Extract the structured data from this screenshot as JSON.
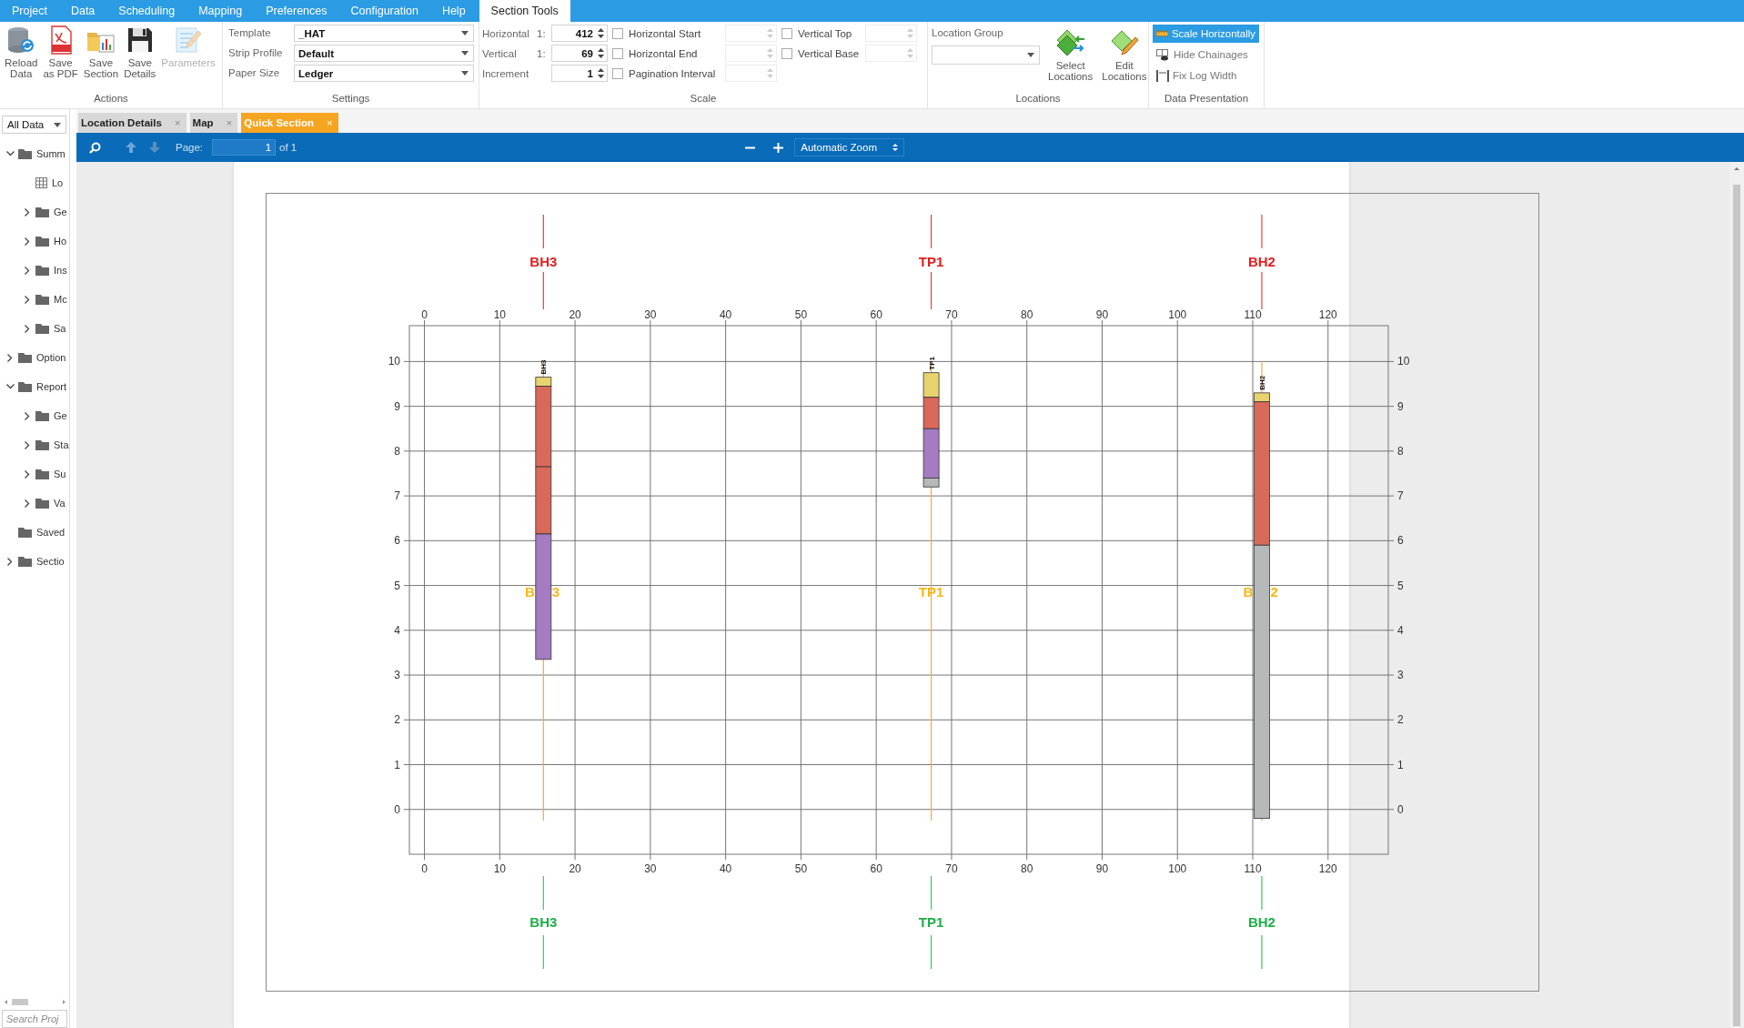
{
  "menu": [
    {
      "label": "Project",
      "selected": false
    },
    {
      "label": "Data",
      "selected": false
    },
    {
      "label": "Scheduling",
      "selected": false
    },
    {
      "label": "Mapping",
      "selected": false
    },
    {
      "label": "Preferences",
      "selected": false
    },
    {
      "label": "Configuration",
      "selected": false
    },
    {
      "label": "Help",
      "selected": false
    },
    {
      "label": "Section Tools",
      "selected": true
    }
  ],
  "ribbon": {
    "actions": {
      "label": "Actions",
      "buttons": [
        {
          "lines": [
            "Reload",
            "Data"
          ],
          "kind": "reload",
          "disabled": false
        },
        {
          "lines": [
            "Save",
            "as PDF"
          ],
          "kind": "pdf",
          "disabled": false
        },
        {
          "lines": [
            "Save",
            "Section"
          ],
          "kind": "section",
          "disabled": false
        },
        {
          "lines": [
            "Save",
            "Details"
          ],
          "kind": "details",
          "disabled": false
        },
        {
          "lines": [
            "Parameters"
          ],
          "kind": "parameters",
          "disabled": true
        }
      ]
    },
    "settings": {
      "label": "Settings",
      "fields": [
        {
          "label": "Template",
          "value": "_HAT"
        },
        {
          "label": "Strip Profile",
          "value": "Default"
        },
        {
          "label": "Paper Size",
          "value": "Ledger"
        }
      ]
    },
    "scale": {
      "label": "Scale",
      "spinners": [
        {
          "label": "Horizontal",
          "prefix": "1:",
          "value": "412"
        },
        {
          "label": "Vertical",
          "prefix": "1:",
          "value": "69"
        },
        {
          "label": "Increment",
          "value": "1"
        }
      ],
      "options": [
        {
          "label": "Horizontal Start",
          "checked": false
        },
        {
          "label": "Horizontal End",
          "checked": false
        },
        {
          "label": "Pagination Interval",
          "checked": false
        }
      ],
      "vertical_options": [
        {
          "label": "Vertical Top",
          "checked": false
        },
        {
          "label": "Vertical Base",
          "checked": false
        }
      ]
    },
    "locations": {
      "label": "Locations",
      "field_label": "Location Group",
      "buttons": [
        {
          "lines": [
            "Select",
            "Locations"
          ],
          "kind": "select"
        },
        {
          "lines": [
            "Edit",
            "Locations"
          ],
          "kind": "edit"
        }
      ]
    },
    "data_presentation": {
      "label": "Data Presentation",
      "toggles": [
        {
          "label": "Scale Horizontally",
          "kind": "ruler",
          "selected": true
        },
        {
          "label": "Hide Chainages",
          "kind": "chainage",
          "selected": false
        },
        {
          "label": "Fix Log Width",
          "kind": "width",
          "selected": false
        }
      ]
    }
  },
  "sidebar": {
    "filter": "All Data",
    "tree": [
      {
        "label": "Summ",
        "kind": "folder",
        "expanded": true,
        "children": [
          {
            "label": "Lo",
            "kind": "table"
          },
          {
            "label": "Ge",
            "kind": "folder",
            "expanded": false
          },
          {
            "label": "Ho",
            "kind": "folder",
            "expanded": false
          },
          {
            "label": "Ins",
            "kind": "folder",
            "expanded": false
          },
          {
            "label": "Mc",
            "kind": "folder",
            "expanded": false
          },
          {
            "label": "Sa",
            "kind": "folder",
            "expanded": false
          }
        ]
      },
      {
        "label": "Option",
        "kind": "folder",
        "expanded": false
      },
      {
        "label": "Report",
        "kind": "folder",
        "expanded": true,
        "children": [
          {
            "label": "Ge",
            "kind": "folder",
            "expanded": false
          },
          {
            "label": "Sta",
            "kind": "folder",
            "expanded": false
          },
          {
            "label": "Su",
            "kind": "folder",
            "expanded": false
          },
          {
            "label": "Va",
            "kind": "folder",
            "expanded": false
          }
        ]
      },
      {
        "label": "Saved",
        "kind": "leaf"
      },
      {
        "label": "Sectio",
        "kind": "folder",
        "expanded": false
      }
    ],
    "search_placeholder": "Search Proj"
  },
  "doc_tabs": [
    {
      "label": "Location Details",
      "close": "×",
      "selected": false
    },
    {
      "label": "Map",
      "close": "×",
      "selected": false
    },
    {
      "label": "Quick Section",
      "close": "×",
      "selected": true
    }
  ],
  "viewer_toolbar": {
    "page_label": "Page:",
    "page": "1",
    "page_count": "of 1",
    "zoom": "Automatic Zoom"
  },
  "section": {
    "bottom_axis_labels": [
      "0",
      "10",
      "20",
      "30",
      "40",
      "50",
      "60",
      "70",
      "80",
      "90",
      "100",
      "110",
      "120"
    ],
    "left_axis_labels": [
      "10",
      "9",
      "8",
      "7",
      "6",
      "5",
      "4",
      "3",
      "2",
      "1",
      "0"
    ],
    "locations": [
      {
        "top_label": "BH3",
        "log_label": "BH3",
        "center_label": [
          "B",
          "3"
        ],
        "bottom_label": "BH3"
      },
      {
        "top_label": "TP1",
        "log_label": "TP1",
        "center_label": [
          "TP1"
        ],
        "bottom_label": "TP1"
      },
      {
        "top_label": "BH2",
        "log_label": "BH2",
        "center_label": [
          "B",
          "2"
        ],
        "bottom_label": "BH2"
      }
    ],
    "chart_data": {
      "type": "bar",
      "grid": true,
      "xlim": [
        -2,
        128
      ],
      "ylim": [
        -1,
        10.8
      ],
      "ref_lines": [
        {
          "axis": "x",
          "value": 15.8,
          "color": "#f6a93b"
        },
        {
          "axis": "x",
          "value": 67.3,
          "color": "#f6a93b"
        },
        {
          "axis": "x",
          "value": 111.2,
          "color": "#f6a93b"
        }
      ],
      "xticks": [
        0,
        10,
        20,
        30,
        40,
        50,
        60,
        70,
        80,
        90,
        100,
        110,
        120
      ],
      "yticks": [
        0,
        1,
        2,
        3,
        4,
        5,
        6,
        7,
        8,
        9,
        10
      ]
    }
  }
}
